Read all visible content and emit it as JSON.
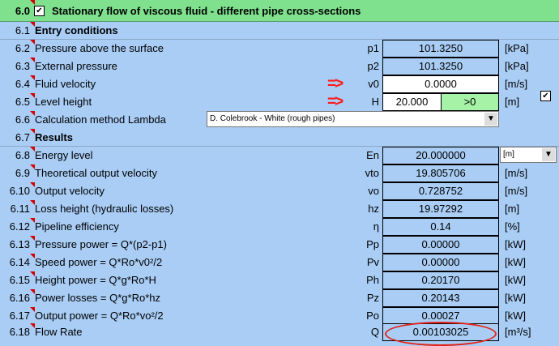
{
  "section": {
    "number": "6.0",
    "title": "Stationary flow of viscous fluid - different pipe cross-sections",
    "checked_glyph": "✔"
  },
  "rows": [
    {
      "num": "6.1",
      "label": "Entry conditions"
    },
    {
      "num": "6.2",
      "label": "Pressure above the surface",
      "symbol": "p1",
      "value": "101.3250",
      "unit": "[kPa]"
    },
    {
      "num": "6.3",
      "label": "External pressure",
      "symbol": "p2",
      "value": "101.3250",
      "unit": "[kPa]"
    },
    {
      "num": "6.4",
      "label": "Fluid velocity",
      "symbol": "v0",
      "value": "0.0000",
      "unit": "[m/s]",
      "arrow": "=>"
    },
    {
      "num": "6.5",
      "label": "Level height",
      "symbol": "H",
      "value": "20.000",
      "extra": ">0",
      "unit": "[m]",
      "arrow": "=>"
    },
    {
      "num": "6.6",
      "label": "Calculation method Lambda",
      "dropdown": "D. Colebrook - White (rough pipes)"
    },
    {
      "num": "6.7",
      "label": "Results"
    },
    {
      "num": "6.8",
      "label": "Energy level",
      "symbol": "En",
      "value": "20.000000",
      "unit_dropdown": "[m]"
    },
    {
      "num": "6.9",
      "label": "Theoretical output velocity",
      "symbol": "vto",
      "value": "19.805706",
      "unit": "[m/s]"
    },
    {
      "num": "6.10",
      "label": "Output velocity",
      "symbol": "vo",
      "value": "0.728752",
      "unit": "[m/s]"
    },
    {
      "num": "6.11",
      "label": "Loss height (hydraulic losses)",
      "symbol": "hz",
      "value": "19.97292",
      "unit": "[m]"
    },
    {
      "num": "6.12",
      "label": "Pipeline efficiency",
      "symbol": "η",
      "value": "0.14",
      "unit": "[%]"
    },
    {
      "num": "6.13",
      "label": "Pressure power = Q*(p2-p1)",
      "symbol": "Pp",
      "value": "0.00000",
      "unit": "[kW]"
    },
    {
      "num": "6.14",
      "label": "Speed power = Q*Ro*v0²/2",
      "symbol": "Pv",
      "value": "0.00000",
      "unit": "[kW]"
    },
    {
      "num": "6.15",
      "label": "Height power = Q*g*Ro*H",
      "symbol": "Ph",
      "value": "0.20170",
      "unit": "[kW]"
    },
    {
      "num": "6.16",
      "label": "Power losses = Q*g*Ro*hz",
      "symbol": "Pz",
      "value": "0.20143",
      "unit": "[kW]"
    },
    {
      "num": "6.17",
      "label": "Output power = Q*Ro*vo²/2",
      "symbol": "Po",
      "value": "0.00027",
      "unit": "[kW]"
    },
    {
      "num": "6.18",
      "label": "Flow Rate",
      "symbol": "Q",
      "value": "0.00103025",
      "unit": "[m³/s]"
    }
  ],
  "colors": {
    "background": "#a9cdf5",
    "header": "#7fe08e",
    "arrow": "#ff1a1a",
    "valid": "#a6f2a6",
    "circle": "#e2231a"
  },
  "icons": {
    "dropdown": "triangle-down-icon",
    "checkbox": "checkbox-icon"
  }
}
